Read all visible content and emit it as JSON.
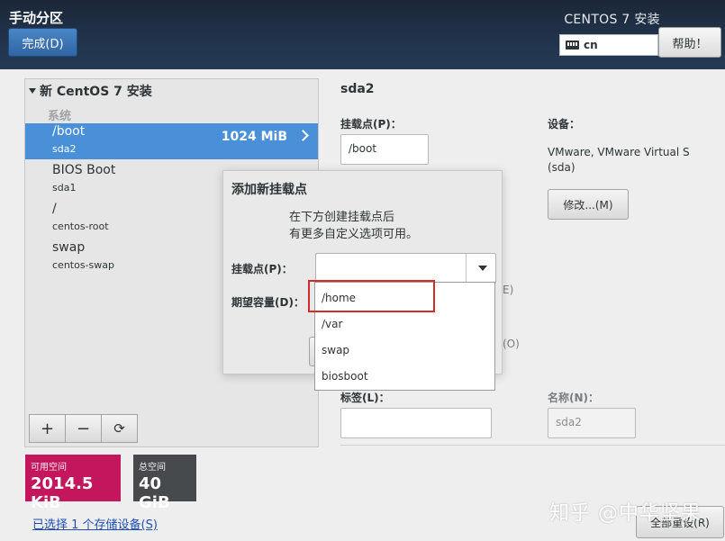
{
  "header": {
    "title": "手动分区",
    "done_button": "完成(D)",
    "install_title": "CENTOS 7 安装",
    "keyboard_layout": "cn",
    "help_button": "帮助！"
  },
  "left_panel": {
    "install_header": "新 CentOS 7 安装",
    "system_label": "系统",
    "partitions": [
      {
        "name": "/boot",
        "device": "sda2",
        "size": "1024 MiB",
        "selected": true
      },
      {
        "name": "BIOS Boot",
        "device": "sda1"
      },
      {
        "name": "/",
        "device": "centos-root"
      },
      {
        "name": "swap",
        "device": "centos-swap"
      }
    ],
    "toolbar": {
      "add": "+",
      "remove": "−",
      "refresh": "⟳"
    }
  },
  "space": {
    "available_label": "可用空间",
    "available_value": "2014.5 KiB",
    "total_label": "总空间",
    "total_value": "40 GiB"
  },
  "selected_devices_link": "已选择 1 个存储设备(S)",
  "right_panel": {
    "title": "sda2",
    "mount_point_label": "挂载点(P)：",
    "mount_point_value": "/boot",
    "device_label": "设备：",
    "device_value_line1": "VMware, VMware Virtual S",
    "device_value_line2": "(sda)",
    "modify_button": "修改...(M)",
    "fragment_e": "E)",
    "fragment_o": "(O)",
    "label_label": "标签(L)：",
    "label_value": "",
    "name_label": "名称(N)：",
    "name_value": "sda2",
    "reset_button": "全部重设(R)"
  },
  "modal": {
    "title": "添加新挂载点",
    "description_line1": "在下方创建挂载点后",
    "description_line2": "有更多自定义选项可用。",
    "mount_point_label": "挂载点(P)：",
    "mount_point_value": "",
    "capacity_label": "期望容量(D)：",
    "dropdown_options": [
      "/home",
      "/var",
      "swap",
      "biosboot"
    ],
    "highlighted_option": "/home"
  },
  "watermark": "知乎 @中华坚果",
  "colors": {
    "header_bg": "#1f2f45",
    "selected_row": "#4a90d9",
    "available_space_bg": "#c3165c",
    "total_space_bg": "#474a4d",
    "highlight_box": "#d32a2a"
  }
}
